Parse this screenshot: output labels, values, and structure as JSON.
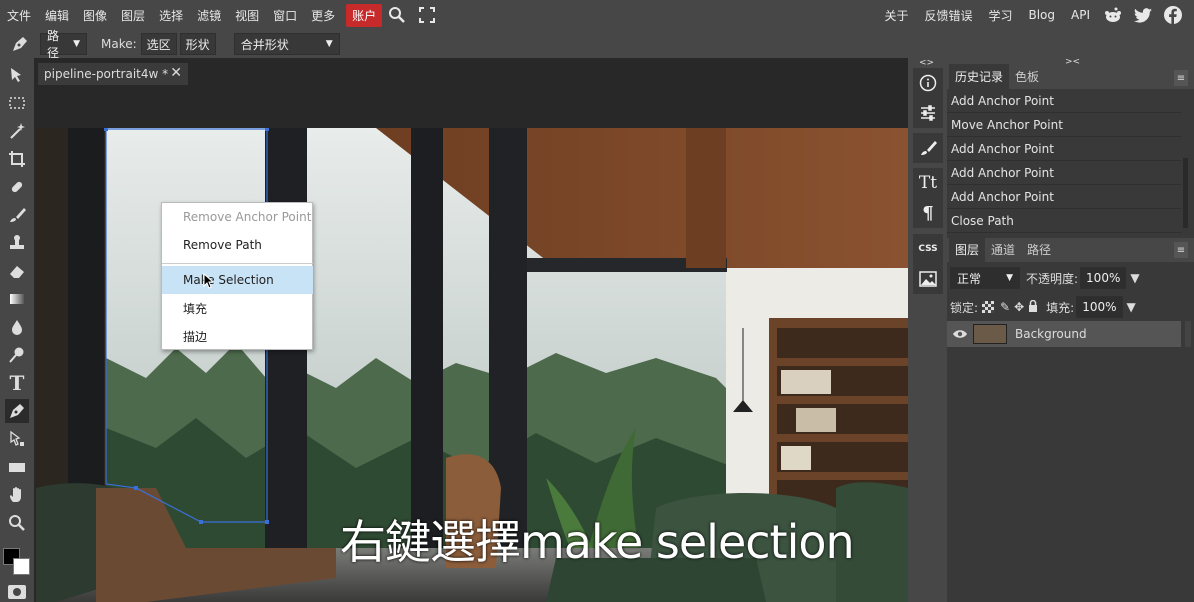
{
  "menu": {
    "items": [
      "文件",
      "编辑",
      "图像",
      "图层",
      "选择",
      "滤镜",
      "视图",
      "窗口",
      "更多"
    ],
    "account": "账户",
    "right_items": [
      "关于",
      "反馈错误",
      "学习",
      "Blog",
      "API"
    ]
  },
  "options": {
    "mode_select": "路径",
    "make_label": "Make:",
    "make_selection": "选区",
    "make_shape": "形状",
    "combine_select": "合并形状"
  },
  "document": {
    "tab_title": "pipeline-portrait4w *",
    "close_symbol": "✕"
  },
  "context_menu": {
    "items": [
      "Remove Anchor Point",
      "Remove Path",
      "Make Selection",
      "填充",
      "描边"
    ]
  },
  "subtitle": "右鍵選擇make selection",
  "history_panel": {
    "tabs": [
      "历史记录",
      "色板"
    ],
    "rows": [
      "Add Anchor Point",
      "Move Anchor Point",
      "Add Anchor Point",
      "Add Anchor Point",
      "Add Anchor Point",
      "Close Path"
    ]
  },
  "layers_panel": {
    "tabs": [
      "图层",
      "通道",
      "路径"
    ],
    "blend_mode": "正常",
    "opacity_label": "不透明度:",
    "opacity_value": "100%",
    "lock_label": "锁定:",
    "fill_label": "填充:",
    "fill_value": "100%",
    "layers": [
      "Background"
    ]
  },
  "collapse_markers": [
    "<>",
    "><"
  ],
  "colors": {
    "account_red": "#c62a2a",
    "context_hover": "#c8e2f6",
    "path_blue": "#3a6fd8",
    "panel_bg": "#393939",
    "ui_bg": "#474747"
  }
}
